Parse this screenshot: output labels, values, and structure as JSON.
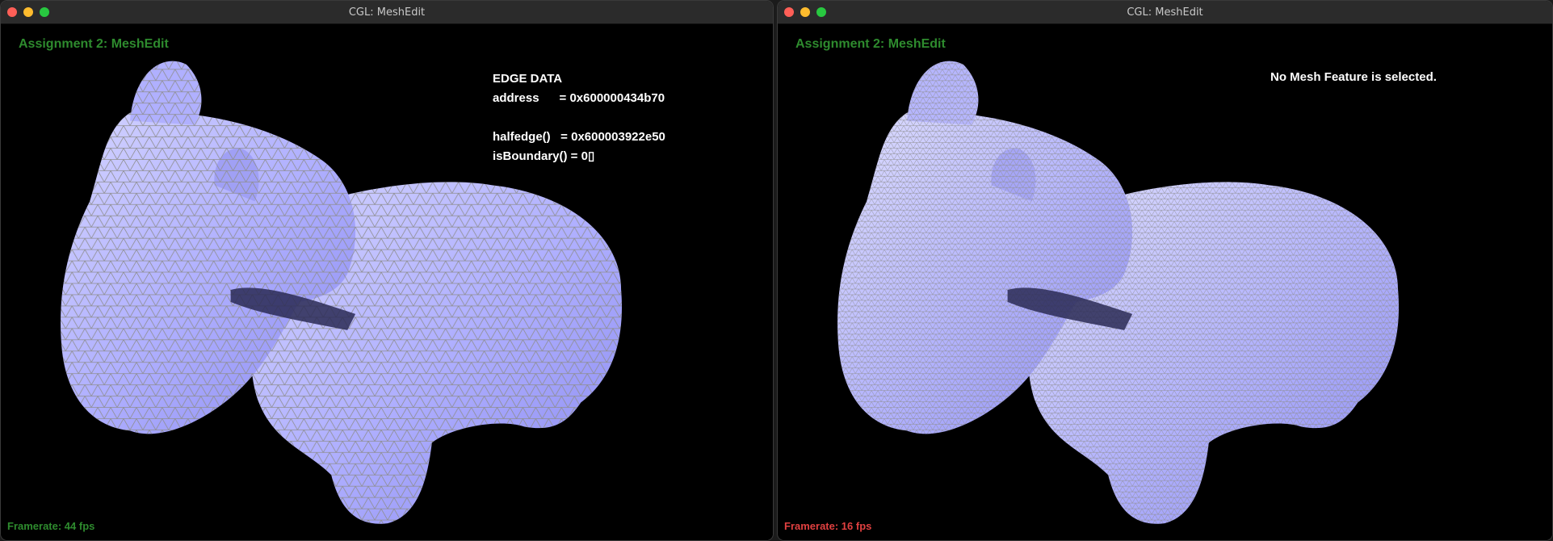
{
  "colors": {
    "app_title": "#2e8b2e",
    "framerate_left": "#2e8b2e",
    "framerate_right": "#e04040",
    "mesh_fill": "#a7a7ff",
    "mesh_lines": "#8e8e8e"
  },
  "left_window": {
    "title": "CGL: MeshEdit",
    "app_title": "Assignment 2: MeshEdit",
    "edge_data": {
      "heading": "EDGE DATA",
      "address": "address      = 0x600000434b70",
      "halfedge": "halfedge()   = 0x600003922e50",
      "is_boundary": "isBoundary() = 0▯"
    },
    "framerate": "Framerate: 44 fps"
  },
  "right_window": {
    "title": "CGL: MeshEdit",
    "app_title": "Assignment 2: MeshEdit",
    "status": "No Mesh Feature is selected.",
    "framerate": "Framerate: 16 fps"
  }
}
